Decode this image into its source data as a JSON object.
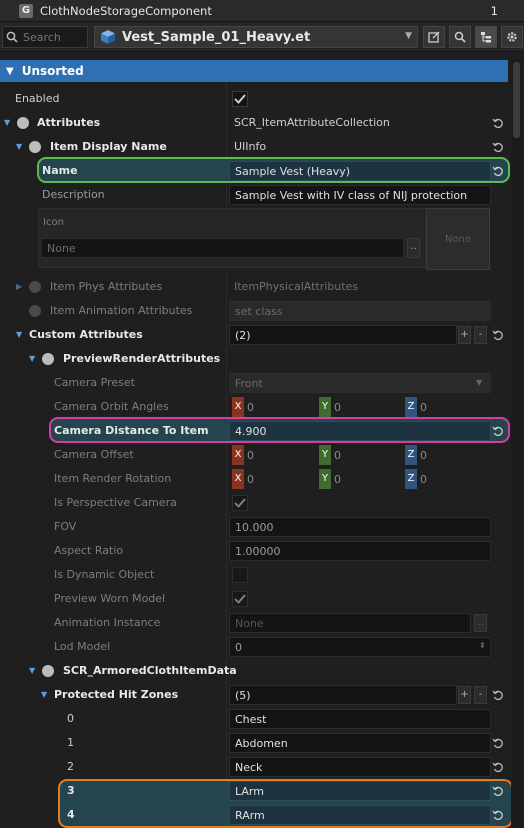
{
  "window": {
    "title": "ClothNodeStorageComponent",
    "count": "1",
    "logo_letter": "G"
  },
  "toolbar": {
    "search_placeholder": "Search",
    "entity_name": "Vest_Sample_01_Heavy.et"
  },
  "section": {
    "title": "Unsorted"
  },
  "rows": {
    "enabled": {
      "label": "Enabled"
    },
    "attributes": {
      "label": "Attributes",
      "value": "SCR_ItemAttributeCollection"
    },
    "item_display_name": {
      "label": "Item Display Name",
      "value": "UIInfo"
    },
    "name": {
      "label": "Name",
      "value": "Sample Vest (Heavy)"
    },
    "description": {
      "label": "Description",
      "value": "Sample Vest with IV class of NIJ protection"
    },
    "icon": {
      "label": "Icon",
      "value": "None",
      "preview": "None"
    },
    "item_phys": {
      "label": "Item Phys Attributes",
      "value": "ItemPhysicalAttributes"
    },
    "item_anim": {
      "label": "Item Animation Attributes",
      "value": "set class"
    },
    "custom": {
      "label": "Custom Attributes",
      "value": "(2)"
    },
    "preview": {
      "label": "PreviewRenderAttributes"
    },
    "camera_preset": {
      "label": "Camera Preset",
      "value": "Front"
    },
    "camera_orbit": {
      "label": "Camera Orbit Angles",
      "x": "0",
      "y": "0",
      "z": "0"
    },
    "camera_distance": {
      "label": "Camera Distance To Item",
      "value": "4.900"
    },
    "camera_offset": {
      "label": "Camera Offset",
      "x": "0",
      "y": "0",
      "z": "0"
    },
    "item_render_rotation": {
      "label": "Item Render Rotation",
      "x": "0",
      "y": "0",
      "z": "0"
    },
    "is_perspective": {
      "label": "Is Perspective Camera"
    },
    "fov": {
      "label": "FOV",
      "value": "10.000"
    },
    "aspect_ratio": {
      "label": "Aspect Ratio",
      "value": "1.00000"
    },
    "is_dynamic": {
      "label": "Is Dynamic Object"
    },
    "preview_worn": {
      "label": "Preview Worn Model"
    },
    "animation_instance": {
      "label": "Animation Instance",
      "value": "None"
    },
    "lod_model": {
      "label": "Lod Model",
      "value": "0"
    },
    "armored": {
      "label": "SCR_ArmoredClothItemData"
    },
    "protected": {
      "label": "Protected Hit Zones",
      "value": "(5)"
    },
    "zone0": {
      "label": "0",
      "value": "Chest"
    },
    "zone1": {
      "label": "1",
      "value": "Abdomen"
    },
    "zone2": {
      "label": "2",
      "value": "Neck"
    },
    "zone3": {
      "label": "3",
      "value": "LArm"
    },
    "zone4": {
      "label": "4",
      "value": "RArm"
    }
  },
  "axis_labels": {
    "x": "X",
    "y": "Y",
    "z": "Z"
  },
  "colors": {
    "section": "#2f6fb3",
    "highlight_green": "#5bbd4c",
    "highlight_pink": "#d33ea0",
    "highlight_orange": "#e07b2a"
  }
}
